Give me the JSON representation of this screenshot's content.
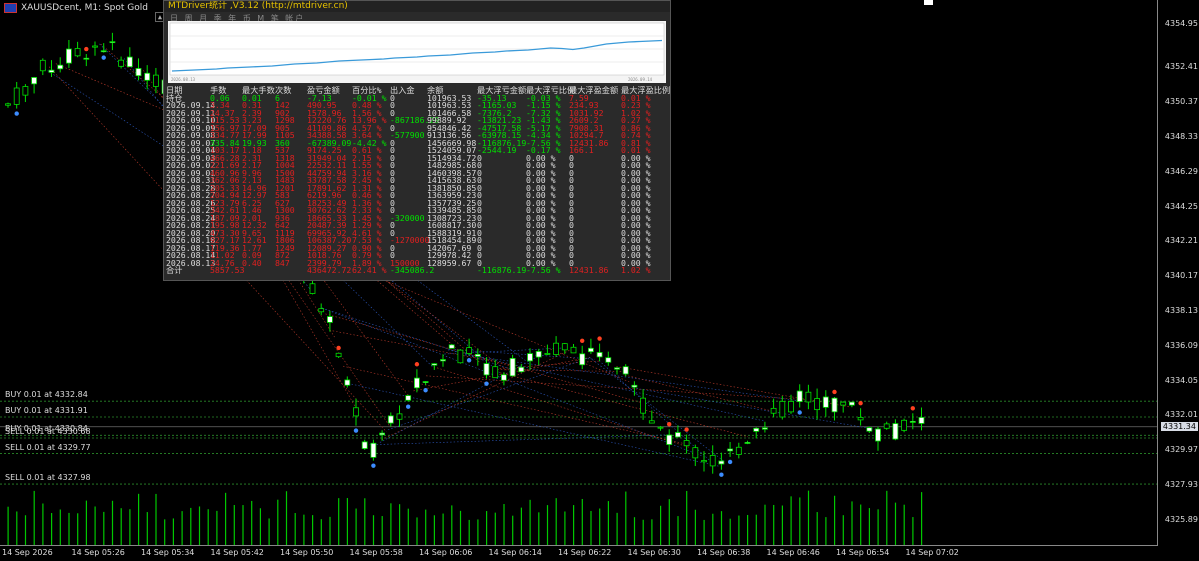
{
  "window": {
    "symbol_title": "XAUUSDcent, M1:  Spot Gold"
  },
  "price_axis": [
    "4354.95",
    "4352.41",
    "4350.37",
    "4348.33",
    "4346.29",
    "4344.25",
    "4342.21",
    "4340.17",
    "4338.13",
    "4336.09",
    "4334.05",
    "4332.01",
    "4329.97",
    "4327.93",
    "4325.89"
  ],
  "current_price": "4331.34",
  "time_axis": [
    "14 Sep 2026",
    "14 Sep 05:26",
    "14 Sep 05:34",
    "14 Sep 05:42",
    "14 Sep 05:50",
    "14 Sep 05:58",
    "14 Sep 06:06",
    "14 Sep 06:14",
    "14 Sep 06:22",
    "14 Sep 06:30",
    "14 Sep 06:38",
    "14 Sep 06:46",
    "14 Sep 06:54",
    "14 Sep 07:02"
  ],
  "orders": [
    {
      "label": "BUY 0.01 at 4332.84",
      "price": 4332.84
    },
    {
      "label": "BUY 0.01 at 4331.91",
      "price": 4331.91
    },
    {
      "label": "BUY 0.01 at 4330.84",
      "price": 4330.84
    },
    {
      "label": "SELL 0.01 at 4330.68",
      "price": 4330.68
    },
    {
      "label": "SELL 0.01 at 4329.77",
      "price": 4329.77
    },
    {
      "label": "SELL 0.01 at 4327.98",
      "price": 4327.98
    }
  ],
  "colors": {
    "bg": "#000000",
    "up": "#00e000",
    "down": "#ffffff",
    "volume": "#00c800",
    "buy_marker": "#3c8cff",
    "sell_marker": "#ff4020",
    "panel_bg": "#2a2a2a",
    "equity_line": "#3a9ad9"
  },
  "panel": {
    "title": "MTDriver统计 ,V3.12 (http://mtdriver.cn)",
    "toolbar": "日 周 月 季 年 币 M 笔 帐户",
    "equity_dates": [
      "2026.08.13",
      "2026.09.14"
    ],
    "headers": [
      "日期",
      "手数",
      "最大手数",
      "次数",
      "盈亏金额",
      "百分比%",
      "出入金",
      "余额",
      "最大浮亏金额",
      "最大浮亏比例",
      "最大浮盈金额",
      "最大浮盈比例"
    ],
    "rows": [
      {
        "c": [
          "持仓",
          "0.06",
          "0.01",
          "6",
          "-7.13",
          "-0.01 %",
          "0",
          "101963.53",
          "-35.13",
          "-0.03 %",
          "7.59",
          "0.01 %"
        ],
        "t": [
          "w",
          "g",
          "g",
          "g",
          "g",
          "g",
          "w",
          "w",
          "g",
          "g",
          "r",
          "r"
        ]
      },
      {
        "c": [
          "2026.09.14",
          "3.34",
          "0.31",
          "142",
          "490.95",
          "0.48 %",
          "0",
          "101963.53",
          "-1165.03",
          "-1.15 %",
          "234.93",
          "0.23 %"
        ],
        "t": [
          "w",
          "r",
          "r",
          "r",
          "r",
          "r",
          "w",
          "w",
          "g",
          "g",
          "r",
          "r"
        ]
      },
      {
        "c": [
          "2026.09.11",
          "24.37",
          "2.39",
          "902",
          "1578.96",
          "1.56 %",
          "0",
          "101466.58",
          "-7376.2",
          "-7.32 %",
          "1031.92",
          "1.02 %"
        ],
        "t": [
          "w",
          "r",
          "r",
          "r",
          "r",
          "r",
          "w",
          "w",
          "g",
          "g",
          "r",
          "r"
        ]
      },
      {
        "c": [
          "2026.09.10",
          "115.53",
          "3.23",
          "1298",
          "12220.76",
          "13.96 %",
          "-867186.29",
          "99889.92",
          "-13821.23",
          "-1.43 %",
          "2609.2",
          "0.27 %"
        ],
        "t": [
          "w",
          "r",
          "r",
          "r",
          "r",
          "r",
          "g",
          "w",
          "g",
          "g",
          "r",
          "r"
        ]
      },
      {
        "c": [
          "2026.09.09",
          "156.97",
          "17.09",
          "905",
          "41109.86",
          "4.57 %",
          "0",
          "954846.42",
          "-47517.58",
          "-5.17 %",
          "7908.31",
          "0.86 %"
        ],
        "t": [
          "w",
          "r",
          "r",
          "r",
          "r",
          "r",
          "w",
          "w",
          "g",
          "g",
          "r",
          "r"
        ]
      },
      {
        "c": [
          "2026.09.08",
          "334.77",
          "17.99",
          "1105",
          "34388.58",
          "3.64 %",
          "-577900",
          "913136.56",
          "-63978.15",
          "-4.34 %",
          "10294.7",
          "0.74 %"
        ],
        "t": [
          "w",
          "r",
          "r",
          "r",
          "r",
          "r",
          "g",
          "w",
          "g",
          "g",
          "r",
          "r"
        ]
      },
      {
        "c": [
          "2026.09.07",
          "335.84",
          "19.93",
          "360",
          "-67389.09",
          "-4.42 %",
          "0",
          "1456669.98",
          "-116876.19",
          "-7.56 %",
          "12431.86",
          "0.81 %"
        ],
        "t": [
          "w",
          "g",
          "g",
          "g",
          "g",
          "g",
          "w",
          "w",
          "g",
          "g",
          "r",
          "r"
        ]
      },
      {
        "c": [
          "2026.09.04",
          "103.17",
          "1.18",
          "537",
          "9174.25",
          "0.61 %",
          "0",
          "1524059.07",
          "-2544.19",
          "-0.17 %",
          "166.1",
          "0.01 %"
        ],
        "t": [
          "w",
          "r",
          "r",
          "r",
          "r",
          "r",
          "w",
          "w",
          "g",
          "g",
          "r",
          "r"
        ]
      },
      {
        "c": [
          "2026.09.03",
          "466.28",
          "2.31",
          "1318",
          "31949.04",
          "2.15 %",
          "0",
          "1514934.72",
          "0",
          "0.00 %",
          "0",
          "0.00 %"
        ],
        "t": [
          "w",
          "r",
          "r",
          "r",
          "r",
          "r",
          "w",
          "w",
          "w",
          "w",
          "w",
          "w"
        ]
      },
      {
        "c": [
          "2026.09.02",
          "221.69",
          "2.17",
          "1004",
          "22532.11",
          "1.55 %",
          "0",
          "1482985.68",
          "0",
          "0.00 %",
          "0",
          "0.00 %"
        ],
        "t": [
          "w",
          "r",
          "r",
          "r",
          "r",
          "r",
          "w",
          "w",
          "w",
          "w",
          "w",
          "w"
        ]
      },
      {
        "c": [
          "2026.09.01",
          "460.96",
          "9.96",
          "1500",
          "44759.94",
          "3.16 %",
          "0",
          "1460398.57",
          "0",
          "0.00 %",
          "0",
          "0.00 %"
        ],
        "t": [
          "w",
          "r",
          "r",
          "r",
          "r",
          "r",
          "w",
          "w",
          "w",
          "w",
          "w",
          "w"
        ]
      },
      {
        "c": [
          "2026.08.31",
          "362.06",
          "2.13",
          "1483",
          "33787.58",
          "2.45 %",
          "0",
          "1415638.63",
          "0",
          "0.00 %",
          "0",
          "0.00 %"
        ],
        "t": [
          "w",
          "r",
          "r",
          "r",
          "r",
          "r",
          "w",
          "w",
          "w",
          "w",
          "w",
          "w"
        ]
      },
      {
        "c": [
          "2026.08.28",
          "205.33",
          "14.96",
          "1201",
          "17891.62",
          "1.31 %",
          "0",
          "1381850.85",
          "0",
          "0.00 %",
          "0",
          "0.00 %"
        ],
        "t": [
          "w",
          "r",
          "r",
          "r",
          "r",
          "r",
          "w",
          "w",
          "w",
          "w",
          "w",
          "w"
        ]
      },
      {
        "c": [
          "2026.08.27",
          "204.94",
          "12.97",
          "583",
          "6219.96",
          "0.46 %",
          "0",
          "1363959.23",
          "0",
          "0.00 %",
          "0",
          "0.00 %"
        ],
        "t": [
          "w",
          "r",
          "r",
          "r",
          "r",
          "r",
          "w",
          "w",
          "w",
          "w",
          "w",
          "w"
        ]
      },
      {
        "c": [
          "2026.08.26",
          "123.79",
          "6.25",
          "627",
          "18253.49",
          "1.36 %",
          "0",
          "1357739.25",
          "0",
          "0.00 %",
          "0",
          "0.00 %"
        ],
        "t": [
          "w",
          "r",
          "r",
          "r",
          "r",
          "r",
          "w",
          "w",
          "w",
          "w",
          "w",
          "w"
        ]
      },
      {
        "c": [
          "2026.08.25",
          "342.61",
          "1.46",
          "1300",
          "30762.62",
          "2.33 %",
          "0",
          "1339485.85",
          "0",
          "0.00 %",
          "0",
          "0.00 %"
        ],
        "t": [
          "w",
          "r",
          "r",
          "r",
          "r",
          "r",
          "w",
          "w",
          "w",
          "w",
          "w",
          "w"
        ]
      },
      {
        "c": [
          "2026.08.24",
          "187.09",
          "2.01",
          "936",
          "18665.33",
          "1.45 %",
          "-320000",
          "1308723.23",
          "0",
          "0.00 %",
          "0",
          "0.00 %"
        ],
        "t": [
          "w",
          "r",
          "r",
          "r",
          "r",
          "r",
          "g",
          "w",
          "w",
          "w",
          "w",
          "w"
        ]
      },
      {
        "c": [
          "2026.08.21",
          "195.98",
          "12.32",
          "642",
          "20487.39",
          "1.29 %",
          "0",
          "1608817.30",
          "0",
          "0.00 %",
          "0",
          "0.00 %"
        ],
        "t": [
          "w",
          "r",
          "r",
          "r",
          "r",
          "r",
          "w",
          "w",
          "w",
          "w",
          "w",
          "w"
        ]
      },
      {
        "c": [
          "2026.08.20",
          "473.30",
          "9.65",
          "1119",
          "69965.92",
          "4.61 %",
          "0",
          "1588319.91",
          "0",
          "0.00 %",
          "0",
          "0.00 %"
        ],
        "t": [
          "w",
          "r",
          "r",
          "r",
          "r",
          "r",
          "w",
          "w",
          "w",
          "w",
          "w",
          "w"
        ]
      },
      {
        "c": [
          "2026.08.18",
          "927.17",
          "12.61",
          "1806",
          "106387.20",
          "7.53 %",
          "-1270000",
          "1518454.89",
          "0",
          "0.00 %",
          "0",
          "0.00 %"
        ],
        "t": [
          "w",
          "r",
          "r",
          "r",
          "r",
          "r",
          "r",
          "w",
          "w",
          "w",
          "w",
          "w"
        ]
      },
      {
        "c": [
          "2026.08.17",
          "119.36",
          "1.77",
          "1249",
          "12089.27",
          "0.90 %",
          "0",
          "142067.69",
          "0",
          "0.00 %",
          "0",
          "0.00 %"
        ],
        "t": [
          "w",
          "r",
          "r",
          "r",
          "r",
          "r",
          "w",
          "w",
          "w",
          "w",
          "w",
          "w"
        ]
      },
      {
        "c": [
          "2026.08.14",
          "11.02",
          "0.09",
          "872",
          "1018.76",
          "0.79 %",
          "0",
          "129978.42",
          "0",
          "0.00 %",
          "0",
          "0.00 %"
        ],
        "t": [
          "w",
          "r",
          "r",
          "r",
          "r",
          "r",
          "w",
          "w",
          "w",
          "w",
          "w",
          "w"
        ]
      },
      {
        "c": [
          "2026.08.13",
          "24.76",
          "0.40",
          "847",
          "2399.79",
          "1.89 %",
          "150000",
          "128959.67",
          "0",
          "0.00 %",
          "0",
          "0.00 %"
        ],
        "t": [
          "w",
          "r",
          "r",
          "r",
          "r",
          "r",
          "r",
          "w",
          "w",
          "w",
          "w",
          "w"
        ]
      },
      {
        "c": [
          "合计",
          "5857.53",
          "",
          "",
          "436472.72",
          "62.41 %",
          "-345086.2",
          "",
          "-116876.19",
          "-7.56 %",
          "12431.86",
          "1.02 %"
        ],
        "t": [
          "w",
          "r",
          "r",
          "r",
          "r",
          "r",
          "g",
          "w",
          "g",
          "g",
          "r",
          "r"
        ]
      }
    ]
  }
}
